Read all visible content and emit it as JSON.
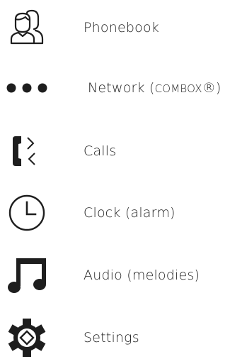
{
  "menu": {
    "items": [
      {
        "id": "phonebook",
        "label": "Phonebook",
        "icon": "contacts-icon"
      },
      {
        "id": "network",
        "label_main": "Network (",
        "label_brand": "COMBOX",
        "label_suffix": "®)",
        "icon": "more-dots-icon"
      },
      {
        "id": "calls",
        "label": "Calls",
        "icon": "phone-calls-icon"
      },
      {
        "id": "clock",
        "label": "Clock (alarm)",
        "icon": "clock-icon"
      },
      {
        "id": "audio",
        "label": "Audio (melodies)",
        "icon": "music-note-icon"
      },
      {
        "id": "settings",
        "label": "Settings",
        "icon": "gear-icon"
      }
    ]
  },
  "colors": {
    "icon": "#1e1e1e",
    "text": "#1e1e1e",
    "background": "#ffffff"
  }
}
